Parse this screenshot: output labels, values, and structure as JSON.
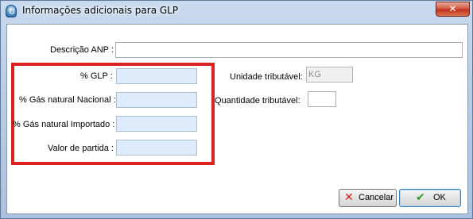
{
  "window": {
    "title": "Informações adicionais para GLP",
    "close_symbol": "✕"
  },
  "form": {
    "descricao_anp": {
      "label": "Descrição ANP :",
      "value": ""
    },
    "glp": {
      "label": "% GLP :",
      "value": ""
    },
    "gas_nacional": {
      "label": "% Gás natural Nacional :",
      "value": ""
    },
    "gas_importado": {
      "label": "% Gás natural Importado :",
      "value": ""
    },
    "valor_partida": {
      "label": "Valor de partida :",
      "value": ""
    },
    "unidade_tributavel": {
      "label": "Unidade tributável:",
      "value": "KG"
    },
    "quantidade_tributavel": {
      "label": "Quantidade tributável:",
      "value": ""
    }
  },
  "buttons": {
    "cancel_label": "Cancelar",
    "cancel_icon": "✕",
    "ok_label": "OK",
    "ok_icon": "✔"
  },
  "colors": {
    "highlight_box": "#dd2222",
    "field_blue": "#ddebfa"
  }
}
